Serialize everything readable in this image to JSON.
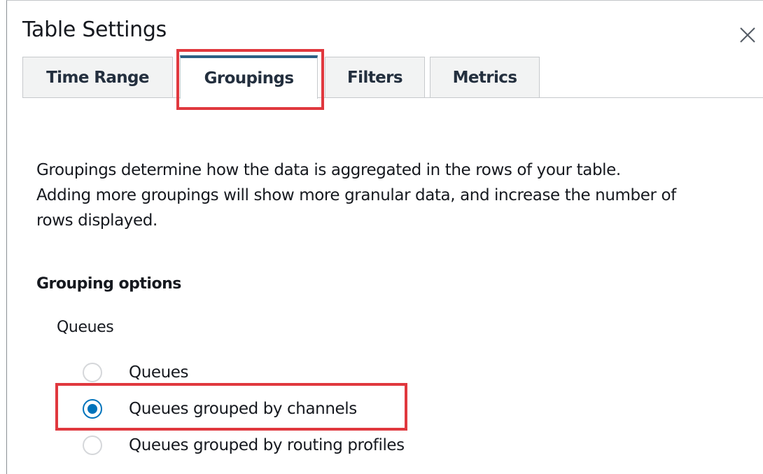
{
  "dialog": {
    "title": "Table Settings"
  },
  "tabs": [
    {
      "label": "Time Range",
      "active": false
    },
    {
      "label": "Groupings",
      "active": true
    },
    {
      "label": "Filters",
      "active": false
    },
    {
      "label": "Metrics",
      "active": false
    }
  ],
  "groupings": {
    "description_lines": [
      "Groupings determine how the data is aggregated in the rows of your table.",
      "Adding more groupings will show more granular data, and increase the number of",
      "rows displayed."
    ],
    "section_title": "Grouping options",
    "group_label": "Queues",
    "options": [
      {
        "label": "Queues",
        "selected": false
      },
      {
        "label": "Queues grouped by channels",
        "selected": true
      },
      {
        "label": "Queues grouped by routing profiles",
        "selected": false
      }
    ]
  },
  "colors": {
    "accent": "#0073bb",
    "highlight": "#e0383e",
    "active_tab_top": "#2b5f84"
  },
  "icons": {
    "close": "close-icon"
  }
}
